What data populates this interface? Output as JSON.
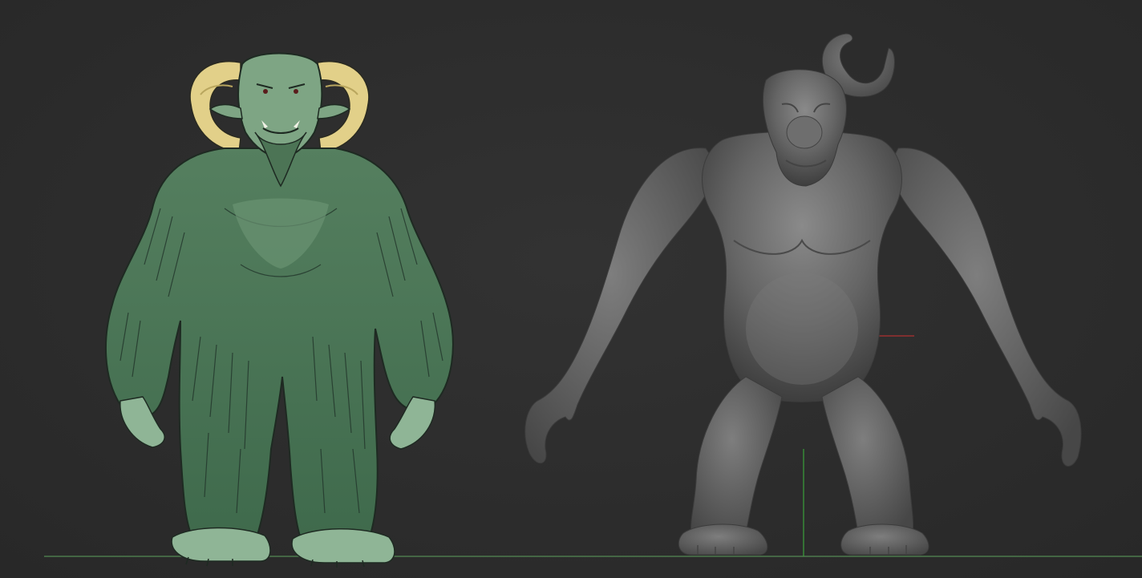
{
  "viewport": {
    "background": "#2d2d2d",
    "floor_grid_color": "#4a7a4a",
    "axis_x_color": "#b03030",
    "axis_y_color": "#3aa03a"
  },
  "scene": {
    "concept_sketch": {
      "fur_color": "#4f7a5a",
      "skin_color": "#8fb596",
      "horn_color": "#e2d089",
      "line_color": "#1e2a22"
    },
    "sculpt_mesh": {
      "clay_color": "#6b6b6b",
      "shadow_color": "#3f3f3f",
      "highlight_color": "#8c8c8c"
    }
  }
}
